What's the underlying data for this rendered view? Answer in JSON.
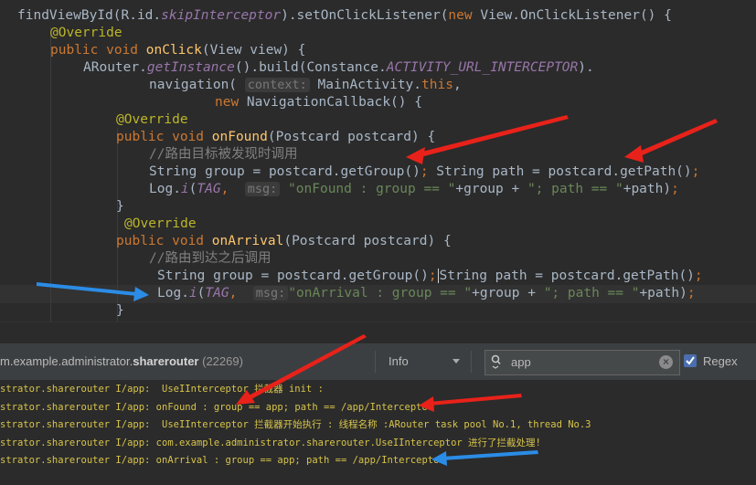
{
  "editor": {
    "lines": [
      {
        "segs": [
          {
            "t": "findViewById(R.id.",
            "c": ""
          },
          {
            "t": "skipInterceptor",
            "c": "it"
          },
          {
            "t": ").setOnClickListener(",
            "c": ""
          },
          {
            "t": "new ",
            "c": "kw"
          },
          {
            "t": "View.OnClickListener() {",
            "c": ""
          }
        ]
      },
      {
        "segs": [
          {
            "t": "@Override",
            "c": "ann"
          }
        ]
      },
      {
        "segs": [
          {
            "t": "public void ",
            "c": "kw"
          },
          {
            "t": "onClick",
            "c": "fn"
          },
          {
            "t": "(View view) {",
            "c": ""
          }
        ]
      },
      {
        "segs": [
          {
            "t": "ARouter.",
            "c": ""
          },
          {
            "t": "getInstance",
            "c": "it"
          },
          {
            "t": "().build(Constance.",
            "c": ""
          },
          {
            "t": "ACTIVITY_URL_INTERCEPTOR",
            "c": "it"
          },
          {
            "t": ").",
            "c": ""
          }
        ]
      },
      {
        "segs": [
          {
            "t": "navigation( ",
            "c": ""
          },
          {
            "t": "context:",
            "c": "hint"
          },
          {
            "t": " MainActivity.",
            "c": ""
          },
          {
            "t": "this",
            "c": "kw"
          },
          {
            "t": ",",
            "c": ""
          }
        ]
      },
      {
        "segs": [
          {
            "t": "new ",
            "c": "kw"
          },
          {
            "t": "NavigationCallback() {",
            "c": ""
          }
        ]
      },
      {
        "segs": [
          {
            "t": "@Override",
            "c": "ann"
          }
        ]
      },
      {
        "segs": [
          {
            "t": "public void ",
            "c": "kw"
          },
          {
            "t": "onFound",
            "c": "fn"
          },
          {
            "t": "(Postcard postcard) {",
            "c": ""
          }
        ]
      },
      {
        "segs": [
          {
            "t": "//路由目标被发现时调用",
            "c": "cmt"
          }
        ]
      },
      {
        "segs": [
          {
            "t": "String group = postcard.getGroup()",
            "c": ""
          },
          {
            "t": "; ",
            "c": "kw"
          },
          {
            "t": "String path = postcard.getPath()",
            "c": ""
          },
          {
            "t": ";",
            "c": "kw"
          }
        ]
      },
      {
        "segs": [
          {
            "t": "Log.",
            "c": ""
          },
          {
            "t": "i",
            "c": "it"
          },
          {
            "t": "(",
            "c": ""
          },
          {
            "t": "TAG",
            "c": "it"
          },
          {
            "t": ",  ",
            "c": "kw"
          },
          {
            "t": "msg:",
            "c": "hint"
          },
          {
            "t": " \"onFound : group == \"",
            "c": "str"
          },
          {
            "t": "+group + ",
            "c": ""
          },
          {
            "t": "\"; path == \"",
            "c": "str"
          },
          {
            "t": "+path)",
            "c": ""
          },
          {
            "t": ";",
            "c": "kw"
          }
        ]
      },
      {
        "segs": [
          {
            "t": "}",
            "c": ""
          }
        ]
      },
      {
        "segs": [
          {
            "t": "@Override",
            "c": "ann"
          }
        ]
      },
      {
        "segs": [
          {
            "t": "public void ",
            "c": "kw"
          },
          {
            "t": "onArrival",
            "c": "fn"
          },
          {
            "t": "(Postcard postcard) {",
            "c": ""
          }
        ]
      },
      {
        "segs": [
          {
            "t": "//路由到达之后调用",
            "c": "cmt"
          }
        ]
      },
      {
        "segs": [
          {
            "t": "String group = postcard.getGroup()",
            "c": ""
          },
          {
            "t": ";",
            "c": "kw"
          },
          {
            "t": "",
            "c": "caret"
          },
          {
            "t": "String path = postcard.getPath()",
            "c": ""
          },
          {
            "t": ";",
            "c": "kw"
          }
        ]
      },
      {
        "segs": [
          {
            "t": "Log.",
            "c": ""
          },
          {
            "t": "i",
            "c": "it"
          },
          {
            "t": "(",
            "c": ""
          },
          {
            "t": "TAG",
            "c": "it"
          },
          {
            "t": ",  ",
            "c": "kw"
          },
          {
            "t": "msg:",
            "c": "hint"
          },
          {
            "t": "\"onArrival : group == \"",
            "c": "str"
          },
          {
            "t": "+group + ",
            "c": ""
          },
          {
            "t": "\"; path == \"",
            "c": "str"
          },
          {
            "t": "+path)",
            "c": ""
          },
          {
            "t": ";",
            "c": "kw"
          }
        ]
      },
      {
        "segs": [
          {
            "t": "}",
            "c": ""
          }
        ]
      }
    ]
  },
  "logcat": {
    "process_package": "m.example.administrator.",
    "process_name": "sharerouter",
    "process_pid": "(22269)",
    "log_level": "Info",
    "search_query": "app",
    "regex_label": "Regex",
    "regex_checked": true,
    "lines": [
      "strator.sharerouter I/app:  UseIInterceptor 拦截器 init :",
      "strator.sharerouter I/app: onFound : group == app; path == /app/Interceptor",
      "strator.sharerouter I/app:  UseIInterceptor 拦截器开始执行 : 线程名称 :ARouter task pool No.1, thread No.3",
      "strator.sharerouter I/app: com.example.administrator.sharerouter.UseIInterceptor 进行了拦截处理!",
      "strator.sharerouter I/app: onArrival : group == app; path == /app/Interceptor"
    ]
  },
  "colors": {
    "annotation_arrow_red": "#e8221a",
    "annotation_arrow_blue": "#2b8ce6"
  }
}
